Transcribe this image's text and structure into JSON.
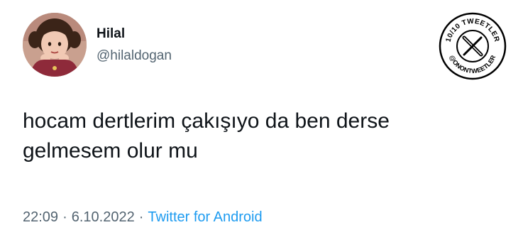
{
  "author": {
    "name": "Hilal",
    "handle": "@hilaldogan"
  },
  "tweet": {
    "text_lines": [
      "hocam dertlerim çakışıyo da ben derse",
      "gelmesem olur mu"
    ]
  },
  "meta": {
    "time": "22:09",
    "date": "6.10.2022",
    "separator": "·",
    "source": "Twitter for Android"
  },
  "badge": {
    "top_text": "10/10 TWEETLER",
    "bottom_text": "@ONONTWEETLER",
    "icon": "x-logo-icon"
  },
  "colors": {
    "text_primary": "#0f1419",
    "text_secondary": "#536471",
    "link": "#1d9bf0"
  }
}
